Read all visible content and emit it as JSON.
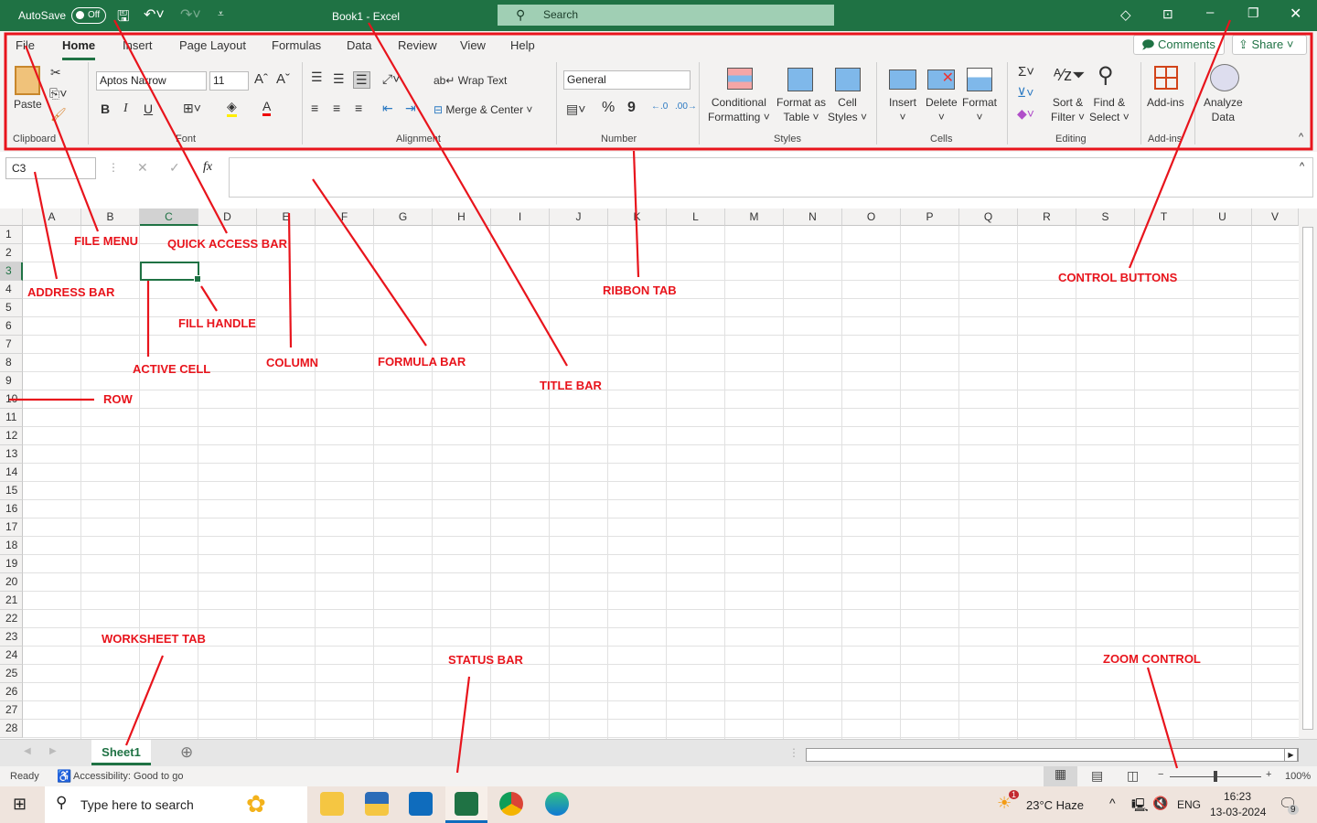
{
  "titlebar": {
    "autosave": "AutoSave",
    "autosave_state": "Off",
    "title": "Book1  -  Excel",
    "search": "Search"
  },
  "tabs": [
    "File",
    "Home",
    "Insert",
    "Page Layout",
    "Formulas",
    "Data",
    "Review",
    "View",
    "Help"
  ],
  "ribbon": {
    "comments": "Comments",
    "share": "Share",
    "paste": "Paste",
    "font_name": "Aptos Narrow",
    "font_size": "11",
    "bold": "B",
    "italic": "I",
    "underline": "U",
    "wrap_text": "Wrap Text",
    "merge_center": "Merge & Center",
    "number_format": "General",
    "percent": "%",
    "comma": "9",
    "conditional": "Conditional",
    "formatting": "Formatting",
    "format_as": "Format as",
    "table": "Table",
    "cell": "Cell",
    "styles_btn": "Styles",
    "insert": "Insert",
    "delete": "Delete",
    "format": "Format",
    "sort": "Sort &",
    "filter": "Filter",
    "find": "Find &",
    "select": "Select",
    "addins": "Add-ins",
    "analyze": "Analyze",
    "data": "Data",
    "groups": [
      "Clipboard",
      "Font",
      "Alignment",
      "Number",
      "Styles",
      "Cells",
      "Editing",
      "Add-ins"
    ]
  },
  "namebox": "C3",
  "fx": "fx",
  "columns": [
    "A",
    "B",
    "C",
    "D",
    "E",
    "F",
    "G",
    "H",
    "I",
    "J",
    "K",
    "L",
    "M",
    "N",
    "O",
    "P",
    "Q",
    "R",
    "S",
    "T",
    "U",
    "V"
  ],
  "rows": [
    "1",
    "2",
    "3",
    "4",
    "5",
    "6",
    "7",
    "8",
    "9",
    "10",
    "11",
    "12",
    "13",
    "14",
    "15",
    "16",
    "17",
    "18",
    "19",
    "20",
    "21",
    "22",
    "23",
    "24",
    "25",
    "26",
    "27",
    "28"
  ],
  "sheet_tab": "Sheet1",
  "status": {
    "ready": "Ready",
    "accessibility": "Accessibility: Good to go",
    "zoom": "100%",
    "zoom_level_percent": 100
  },
  "taskbar": {
    "search": "Type here to search",
    "weather": "23°C  Haze",
    "weather_badge": "1",
    "lang": "ENG",
    "time": "16:23",
    "date": "13-03-2024",
    "notifications": "9"
  },
  "annotations": {
    "file_menu": "FILE MENU",
    "quick_access": "QUICK ACCESS BAR",
    "address_bar": "ADDRESS BAR",
    "fill_handle": "FILL HANDLE",
    "active_cell": "ACTIVE CELL",
    "column": "COLUMN",
    "formula_bar": "FORMULA BAR",
    "title_bar": "TITLE BAR",
    "ribbon_tab": "RIBBON TAB",
    "control_buttons": "CONTROL BUTTONS",
    "row": "ROW",
    "worksheet_tab": "WORKSHEET TAB",
    "status_bar": "STATUS BAR",
    "zoom_control": "ZOOM CONTROL"
  },
  "colors": {
    "excel_green": "#1f7244",
    "annotation_red": "#e8141c"
  }
}
